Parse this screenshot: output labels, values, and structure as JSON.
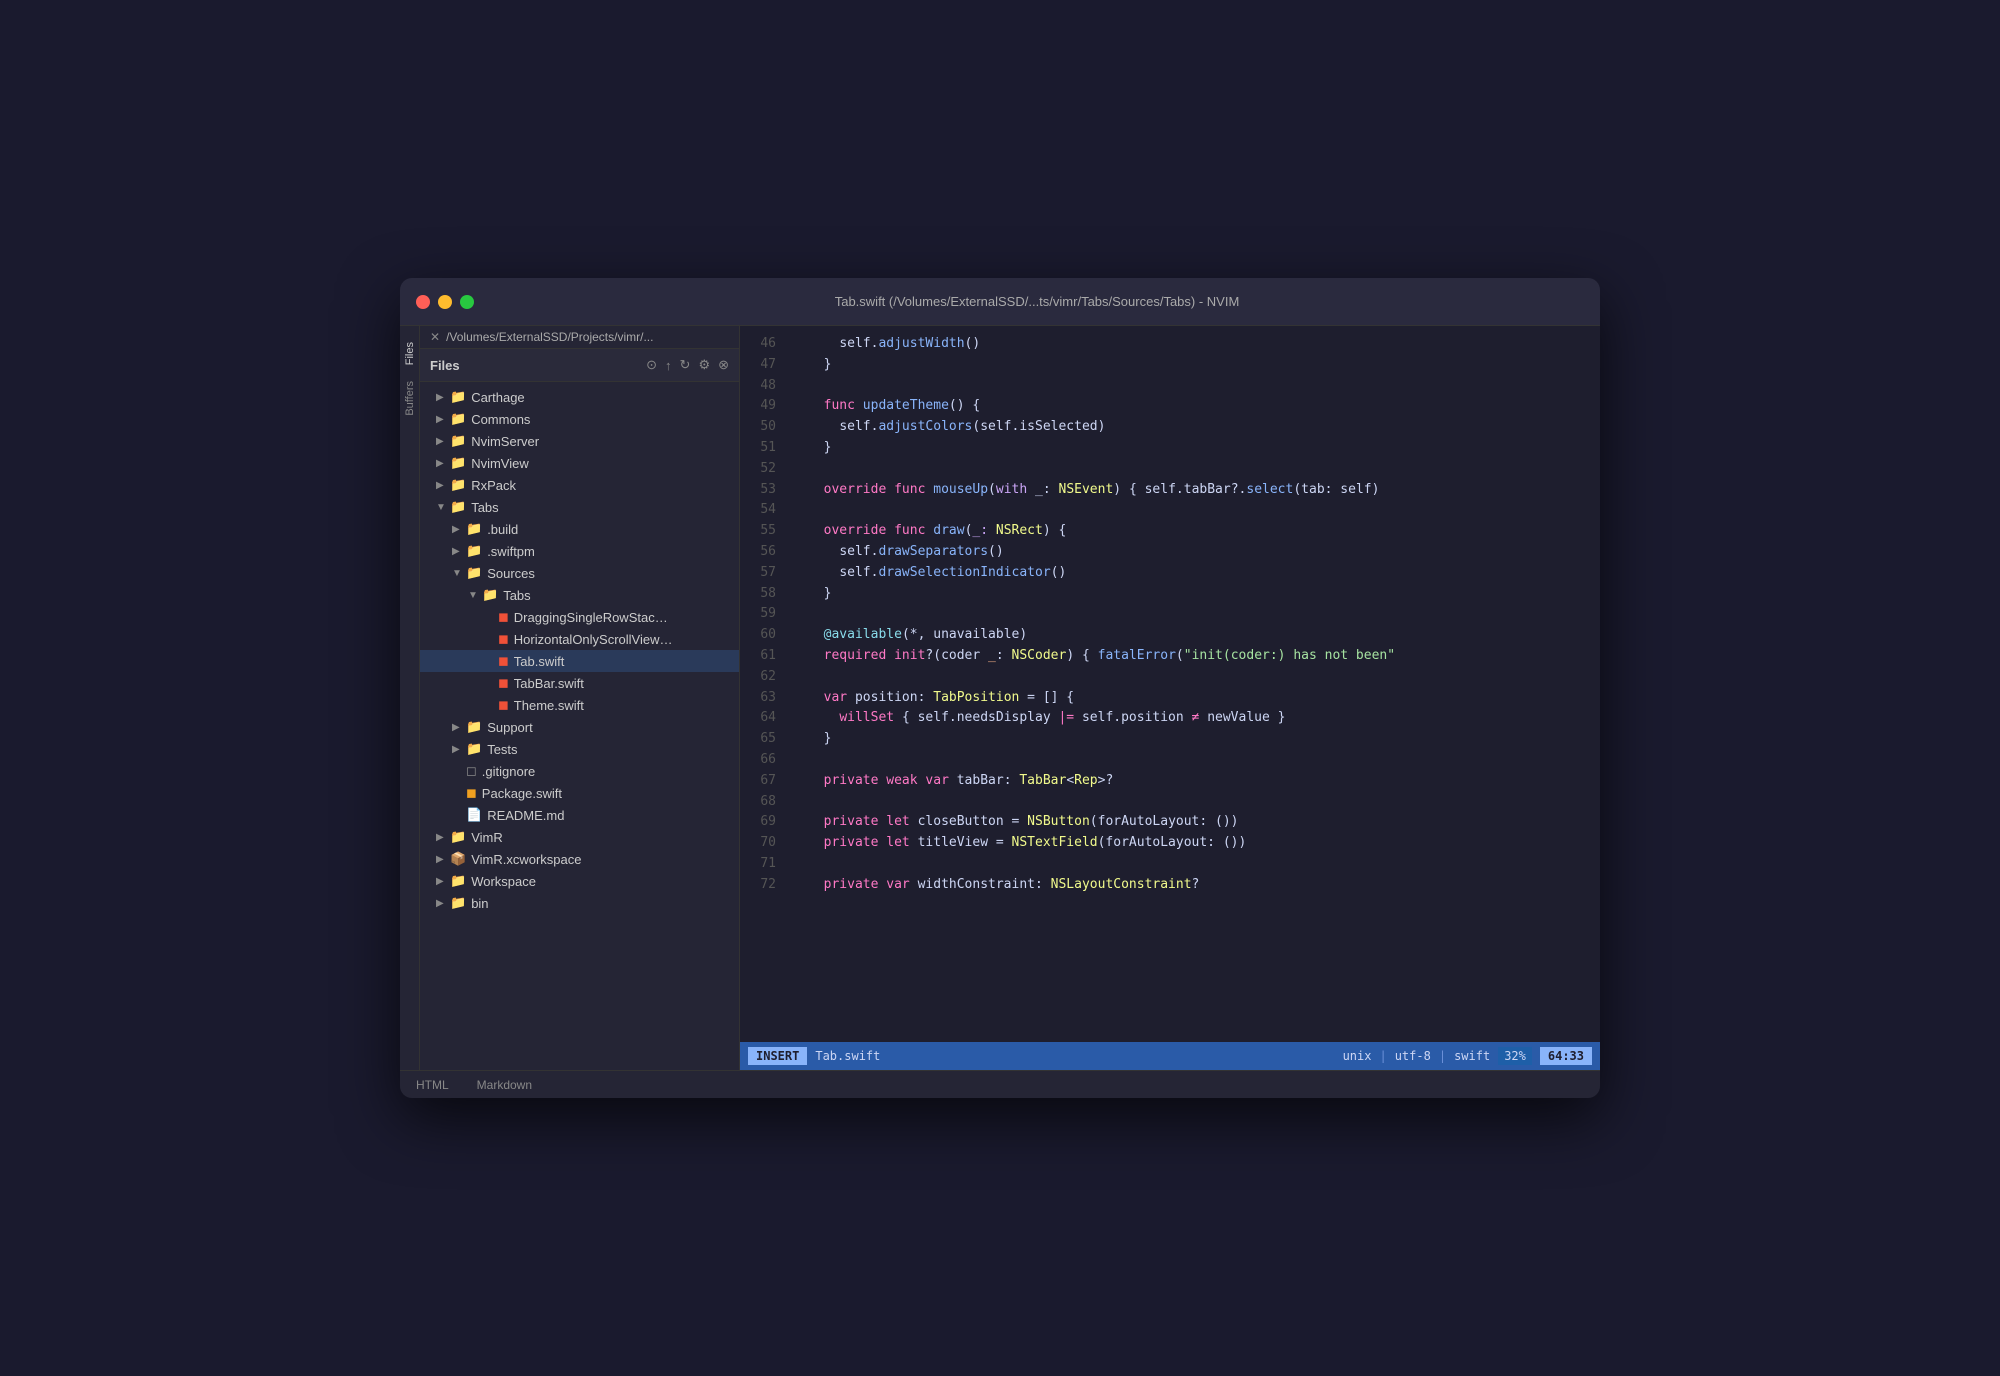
{
  "window": {
    "title": "Tab.swift (/Volumes/ExternalSSD/...ts/vimr/Tabs/Sources/Tabs) - NVIM"
  },
  "titlebar": {
    "path": "/Volumes/ExternalSSD/Projects/vimr/...",
    "close_icon": "✕"
  },
  "sidebar_tabs": [
    {
      "label": "Files",
      "active": true
    },
    {
      "label": "Buffers",
      "active": false
    }
  ],
  "file_panel": {
    "title": "Files",
    "tree": [
      {
        "level": 1,
        "type": "folder",
        "collapsed": true,
        "name": "Carthage"
      },
      {
        "level": 1,
        "type": "folder",
        "collapsed": true,
        "name": "Commons"
      },
      {
        "level": 1,
        "type": "folder",
        "collapsed": true,
        "name": "NvimServer"
      },
      {
        "level": 1,
        "type": "folder",
        "collapsed": true,
        "name": "NvimView"
      },
      {
        "level": 1,
        "type": "folder",
        "collapsed": true,
        "name": "RxPack"
      },
      {
        "level": 1,
        "type": "folder",
        "collapsed": false,
        "name": "Tabs"
      },
      {
        "level": 2,
        "type": "folder",
        "collapsed": true,
        "name": ".build"
      },
      {
        "level": 2,
        "type": "folder",
        "collapsed": true,
        "name": ".swiftpm"
      },
      {
        "level": 2,
        "type": "folder",
        "collapsed": false,
        "name": "Sources"
      },
      {
        "level": 3,
        "type": "folder",
        "collapsed": false,
        "name": "Tabs"
      },
      {
        "level": 4,
        "type": "swift",
        "name": "DraggingSingleRowStac..."
      },
      {
        "level": 4,
        "type": "swift",
        "name": "HorizontalOnlyScrollView..."
      },
      {
        "level": 4,
        "type": "swift",
        "name": "Tab.swift",
        "active": true
      },
      {
        "level": 4,
        "type": "swift",
        "name": "TabBar.swift"
      },
      {
        "level": 4,
        "type": "swift",
        "name": "Theme.swift"
      },
      {
        "level": 2,
        "type": "folder",
        "collapsed": true,
        "name": "Support"
      },
      {
        "level": 2,
        "type": "folder",
        "collapsed": true,
        "name": "Tests"
      },
      {
        "level": 2,
        "type": "generic",
        "name": ".gitignore"
      },
      {
        "level": 2,
        "type": "pkg",
        "name": "Package.swift"
      },
      {
        "level": 2,
        "type": "md",
        "name": "README.md"
      },
      {
        "level": 1,
        "type": "folder",
        "collapsed": true,
        "name": "VimR"
      },
      {
        "level": 1,
        "type": "xcworkspace",
        "name": "VimR.xcworkspace"
      },
      {
        "level": 1,
        "type": "folder",
        "collapsed": true,
        "name": "Workspace"
      },
      {
        "level": 1,
        "type": "folder",
        "collapsed": true,
        "name": "bin"
      }
    ]
  },
  "code": {
    "lines": [
      {
        "num": 46,
        "content": "    self.adjustWidth()"
      },
      {
        "num": 47,
        "content": "  }"
      },
      {
        "num": 48,
        "content": ""
      },
      {
        "num": 49,
        "content": "  func updateTheme() {"
      },
      {
        "num": 50,
        "content": "    self.adjustColors(self.isSelected)"
      },
      {
        "num": 51,
        "content": "  }"
      },
      {
        "num": 52,
        "content": ""
      },
      {
        "num": 53,
        "content": "  override func mouseUp(with _: NSEvent) { self.tabBar?.select(tab: self)"
      },
      {
        "num": 54,
        "content": ""
      },
      {
        "num": 55,
        "content": "  override func draw(_: NSRect) {"
      },
      {
        "num": 56,
        "content": "    self.drawSeparators()"
      },
      {
        "num": 57,
        "content": "    self.drawSelectionIndicator()"
      },
      {
        "num": 58,
        "content": "  }"
      },
      {
        "num": 59,
        "content": ""
      },
      {
        "num": 60,
        "content": "  @available(*, unavailable)"
      },
      {
        "num": 61,
        "content": "  required init?(coder _: NSCoder) { fatalError(\"init(coder:) has not been"
      },
      {
        "num": 62,
        "content": ""
      },
      {
        "num": 63,
        "content": "  var position: TabPosition = [] {"
      },
      {
        "num": 64,
        "content": "    willSet { self.needsDisplay |= self.position ≠ newValue }"
      },
      {
        "num": 65,
        "content": "  }"
      },
      {
        "num": 66,
        "content": ""
      },
      {
        "num": 67,
        "content": "  private weak var tabBar: TabBar<Rep>?"
      },
      {
        "num": 68,
        "content": ""
      },
      {
        "num": 69,
        "content": "  private let closeButton = NSButton(forAutoLayout: ())"
      },
      {
        "num": 70,
        "content": "  private let titleView = NSTextField(forAutoLayout: ())"
      },
      {
        "num": 71,
        "content": ""
      },
      {
        "num": 72,
        "content": "  private var widthConstraint: NSLayoutConstraint?"
      }
    ]
  },
  "status_bar": {
    "mode": "INSERT",
    "filename": "Tab.swift",
    "encoding": "unix",
    "format": "utf-8",
    "filetype": "swift",
    "percent": "32%",
    "position": "64:33"
  },
  "bottom_tabs": [
    {
      "label": "HTML",
      "active": false
    },
    {
      "label": "Markdown",
      "active": false
    }
  ]
}
